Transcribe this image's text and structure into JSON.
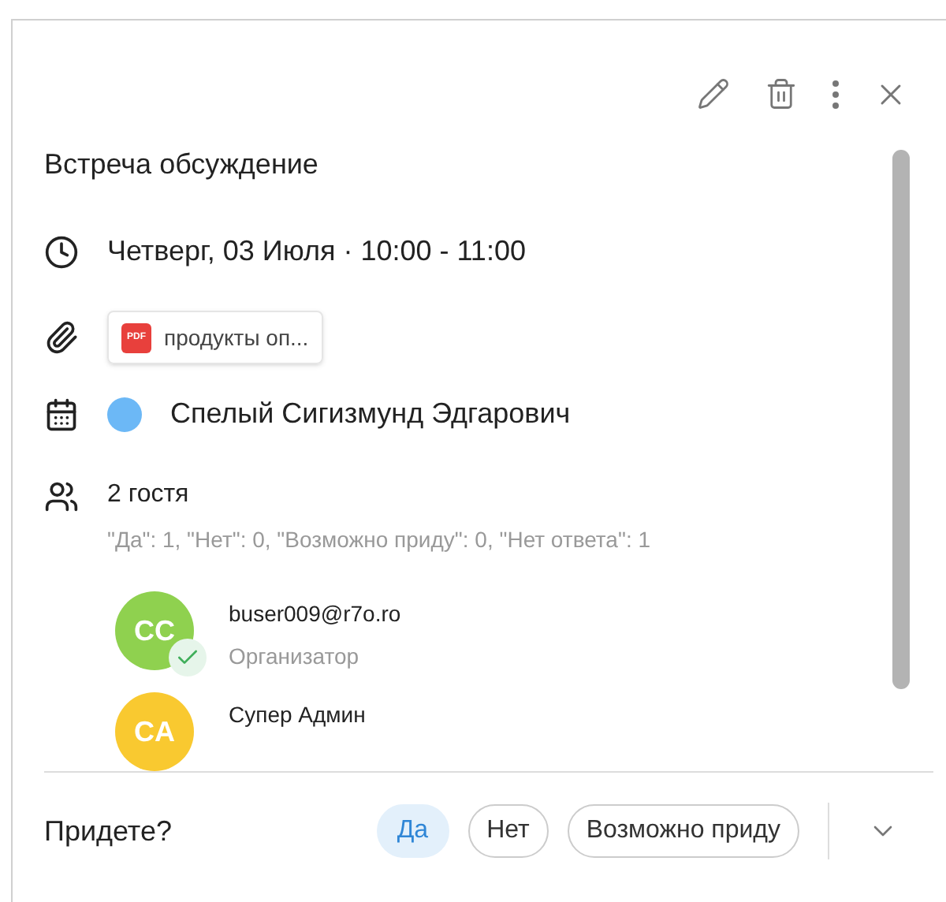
{
  "event": {
    "title": "Встреча обсуждение",
    "datetime": "Четверг, 03 Июля · 10:00 - 11:00",
    "attachment": {
      "name": "продукты оп...",
      "badge": "PDF"
    },
    "calendar": {
      "name": "Спелый Сигизмунд Эдгарович",
      "color": "#6cb8f6"
    },
    "guests_count": "2 гостя",
    "guests_summary": "\"Да\": 1, \"Нет\": 0, \"Возможно приду\": 0, \"Нет ответа\": 1",
    "guests": [
      {
        "initials": "CC",
        "name": "buser009@r7o.ro",
        "role": "Организатор",
        "color": "#8fd14f",
        "accepted": true
      },
      {
        "initials": "CA",
        "name": "Супер Админ",
        "color": "#f9c930",
        "accepted": false
      }
    ]
  },
  "footer": {
    "question": "Придете?",
    "options": [
      {
        "label": "Да",
        "selected": true
      },
      {
        "label": "Нет",
        "selected": false
      },
      {
        "label": "Возможно приду",
        "selected": false
      }
    ]
  }
}
